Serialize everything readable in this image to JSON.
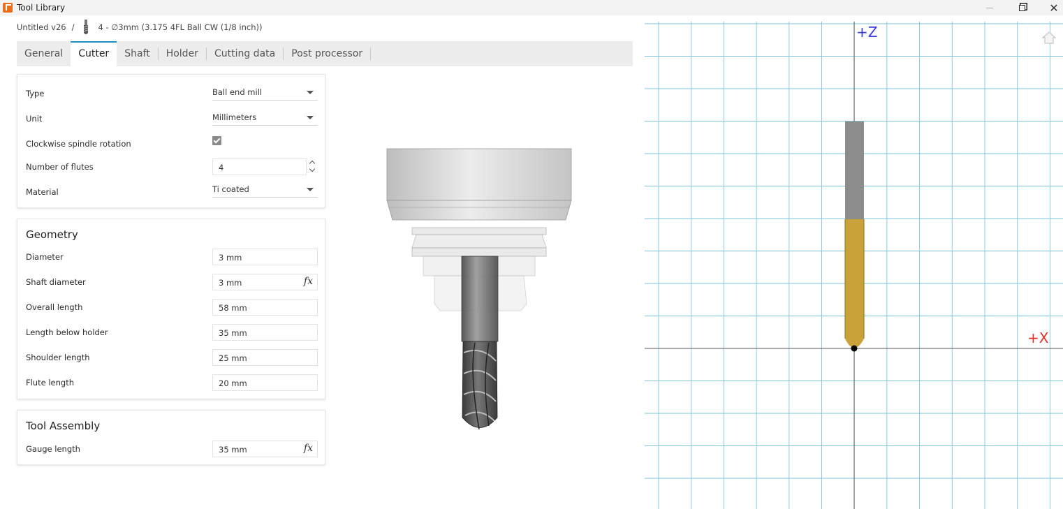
{
  "window": {
    "title": "Tool Library"
  },
  "breadcrumb": {
    "document": "Untitled v26",
    "separator": "/",
    "tool": "4 - ∅3mm (3.175 4FL Ball CW (1/8 inch))"
  },
  "tabs": [
    "General",
    "Cutter",
    "Shaft",
    "Holder",
    "Cutting data",
    "Post processor"
  ],
  "active_tab": "Cutter",
  "cutter": {
    "type_label": "Type",
    "type_value": "Ball end mill",
    "unit_label": "Unit",
    "unit_value": "Millimeters",
    "cw_label": "Clockwise spindle rotation",
    "cw_checked": true,
    "flutes_label": "Number of flutes",
    "flutes_value": "4",
    "material_label": "Material",
    "material_value": "Ti coated"
  },
  "geometry": {
    "title": "Geometry",
    "diameter_label": "Diameter",
    "diameter_value": "3 mm",
    "shaft_label": "Shaft diameter",
    "shaft_value": "3 mm",
    "overall_label": "Overall length",
    "overall_value": "58 mm",
    "below_label": "Length below holder",
    "below_value": "35 mm",
    "shoulder_label": "Shoulder length",
    "shoulder_value": "25 mm",
    "flute_label": "Flute length",
    "flute_value": "20 mm",
    "fx": "fx"
  },
  "assembly": {
    "title": "Tool Assembly",
    "gauge_label": "Gauge length",
    "gauge_value": "35 mm",
    "fx": "fx"
  },
  "viewport": {
    "z_label": "+Z",
    "x_label": "+X",
    "grid_color": "#7ec3dc",
    "axis_color": "#5a5a5a",
    "axis_label_color_z": "#3a3ae0",
    "axis_label_color_x": "#e0302a",
    "shank_color": "#8c8c8c",
    "flute_color": "#c9a23a"
  },
  "icons": [
    "app-icon",
    "tool-thumb-icon",
    "minimize-icon",
    "restore-icon",
    "close-icon",
    "dropdown-caret-icon",
    "checkbox-check-icon",
    "stepper-icon",
    "fx-icon",
    "home-view-icon"
  ]
}
